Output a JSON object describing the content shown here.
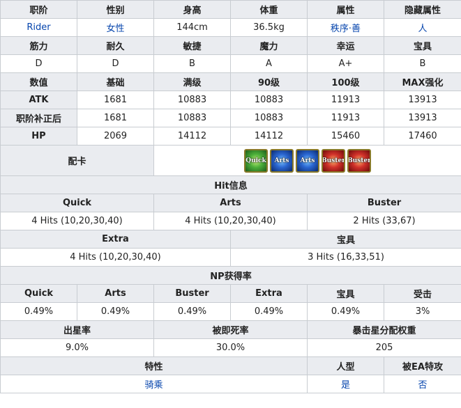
{
  "basic": {
    "headers": [
      "职阶",
      "性别",
      "身高",
      "体重",
      "属性",
      "隐藏属性"
    ],
    "class": "Rider",
    "gender": "女性",
    "height": "144cm",
    "weight": "36.5kg",
    "alignment": "秩序·善",
    "hidden_attribute": "人"
  },
  "params": {
    "headers": [
      "筋力",
      "耐久",
      "敏捷",
      "魔力",
      "幸运",
      "宝具"
    ],
    "values": [
      "D",
      "D",
      "B",
      "A",
      "A+",
      "B"
    ]
  },
  "growth": {
    "headers": [
      "数值",
      "基础",
      "满级",
      "90级",
      "100级",
      "MAX强化"
    ],
    "rows": [
      {
        "label": "ATK",
        "values": [
          "1681",
          "10883",
          "10883",
          "11913",
          "13913"
        ]
      },
      {
        "label": "职阶补正后",
        "values": [
          "1681",
          "10883",
          "10883",
          "11913",
          "13913"
        ]
      },
      {
        "label": "HP",
        "values": [
          "2069",
          "14112",
          "14112",
          "15460",
          "17460"
        ]
      }
    ]
  },
  "deck": {
    "label": "配卡",
    "cards": [
      {
        "type": "quick",
        "text": "Quick"
      },
      {
        "type": "arts",
        "text": "Arts"
      },
      {
        "type": "arts",
        "text": "Arts"
      },
      {
        "type": "buster",
        "text": "Buster"
      },
      {
        "type": "buster",
        "text": "Buster"
      }
    ]
  },
  "hits": {
    "title": "Hit信息",
    "quick_label": "Quick",
    "arts_label": "Arts",
    "buster_label": "Buster",
    "quick": "4 Hits (10,20,30,40)",
    "arts": "4 Hits (10,20,30,40)",
    "buster": "2 Hits (33,67)",
    "extra_label": "Extra",
    "np_label": "宝具",
    "extra": "4 Hits (10,20,30,40)",
    "np": "3 Hits (16,33,51)"
  },
  "np_gain": {
    "title": "NP获得率",
    "headers": [
      "Quick",
      "Arts",
      "Buster",
      "Extra",
      "宝具",
      "受击"
    ],
    "values": [
      "0.49%",
      "0.49%",
      "0.49%",
      "0.49%",
      "0.49%",
      "3%"
    ]
  },
  "stars": {
    "headers": [
      "出星率",
      "被即死率",
      "暴击星分配权重"
    ],
    "values": [
      "9.0%",
      "30.0%",
      "205"
    ]
  },
  "traits": {
    "headers": [
      "特性",
      "人型",
      "被EA特攻"
    ],
    "trait": "骑乘",
    "humanoid": "是",
    "ea_weak": "否"
  },
  "colors": {
    "header_bg": "#eaecf0",
    "border": "#c8ccd1",
    "link": "#0645ad"
  }
}
